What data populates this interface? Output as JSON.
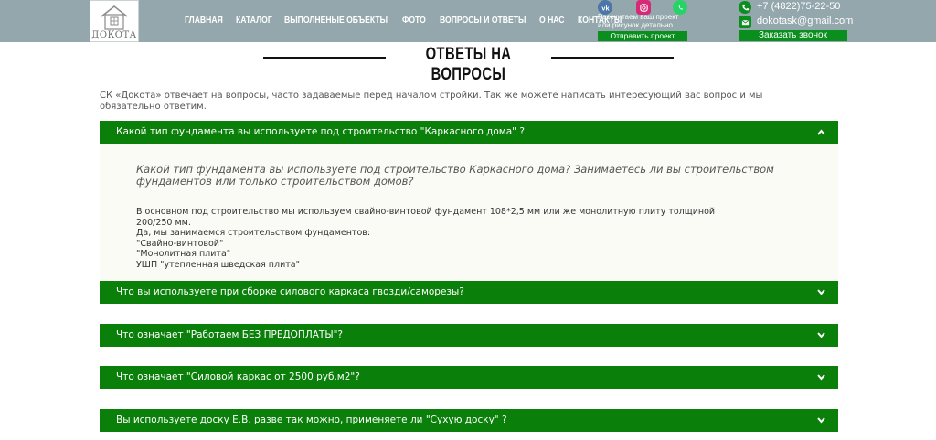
{
  "header": {
    "logo_text": "ДОКОТА",
    "nav": [
      "ГЛАВНАЯ",
      "КАТАЛОГ",
      "ВЫПОЛНЕНЫЕ ОБЪЕКТЫ",
      "ФОТО",
      "ВОПРОСЫ И ОТВЕТЫ",
      "О НАС",
      "КОНТАКТЫ"
    ],
    "project_text_line1": "Рассчитаем ваш проект",
    "project_text_line2": "или рисунок детально",
    "project_button": "Отправить проект",
    "phone": "+7 (4822)75-22-50",
    "email": "dokotask@gmail.com",
    "call_button": "Заказать звонок",
    "colors": {
      "header_bg": "#93a7ac",
      "accent_green": "#0a8f1e"
    }
  },
  "page": {
    "title": "ОТВЕТЫ НА ВОПРОСЫ",
    "intro_line1": "СК «Докота» отвечает на вопросы, часто задаваемые перед началом стройки. Так же можете написать интересующий вас вопрос и мы",
    "intro_line2": "обязательно ответим."
  },
  "faq": {
    "items": [
      {
        "question": "Какой тип фундамента вы используете под строительство \"Каркасного дома\" ?",
        "expanded": true
      },
      {
        "question": "Что вы используете при сборке силового каркаса гвозди/саморезы?",
        "expanded": false
      },
      {
        "question": "Что означает \"Работаем БЕЗ ПРЕДОПЛАТЫ\"?",
        "expanded": false
      },
      {
        "question": "Что означает \"Силовой каркас от 2500 руб.м2\"?",
        "expanded": false
      },
      {
        "question": "Вы используете доску Е.В. разве так можно, применяете ли \"Сухую доску\" ?",
        "expanded": false
      }
    ],
    "answer": {
      "title_line1": "Какой тип фундамента вы используете под строительство Каркасного дома? Занимаетесь ли вы строительством",
      "title_line2": "фундаментов или только строительством домов?",
      "lines": [
        "В основном под строительство мы используем свайно-винтовой фундамент 108*2,5 мм или же монолитную плиту толщиной",
        "200/250 мм.",
        "Да, мы занимаемся строительством фундаментов:",
        "\"Свайно-винтовой\"",
        "\"Монолитная плита\"",
        "УШП \"утепленная шведская плита\""
      ]
    },
    "colors": {
      "bar": "#0a7f0a",
      "answer_bg": "#fbfbf6"
    }
  }
}
